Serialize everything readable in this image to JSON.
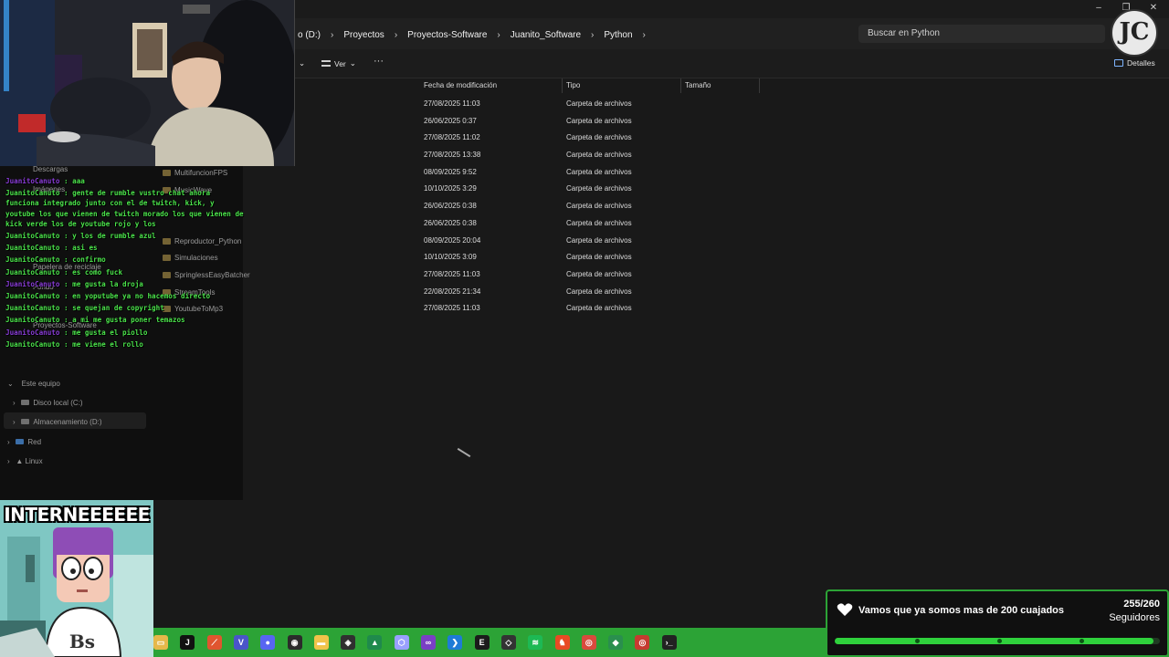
{
  "window": {
    "minimize_glyph": "–",
    "maximize_glyph": "❐",
    "close_glyph": "✕"
  },
  "address": {
    "crumbs": [
      "o (D:)",
      "Proyectos",
      "Proyectos-Software",
      "Juanito_Software",
      "Python"
    ],
    "chevron": "›",
    "search_placeholder": "Buscar en Python"
  },
  "toolbar": {
    "view_label": "Ver",
    "more_label": "···",
    "details_label": "Detalles"
  },
  "list": {
    "columns": [
      "Fecha de modificación",
      "Tipo",
      "Tamaño"
    ],
    "rows": [
      {
        "date": "27/08/2025 11:03",
        "type": "Carpeta de archivos"
      },
      {
        "date": "26/06/2025 0:37",
        "type": "Carpeta de archivos"
      },
      {
        "date": "27/08/2025 11:02",
        "type": "Carpeta de archivos"
      },
      {
        "date": "27/08/2025 13:38",
        "type": "Carpeta de archivos"
      },
      {
        "date": "08/09/2025 9:52",
        "type": "Carpeta de archivos"
      },
      {
        "date": "10/10/2025 3:29",
        "type": "Carpeta de archivos"
      },
      {
        "date": "26/06/2025 0:38",
        "type": "Carpeta de archivos"
      },
      {
        "date": "26/06/2025 0:38",
        "type": "Carpeta de archivos"
      },
      {
        "date": "08/09/2025 20:04",
        "type": "Carpeta de archivos"
      },
      {
        "date": "10/10/2025 3:09",
        "type": "Carpeta de archivos"
      },
      {
        "date": "27/08/2025 11:03",
        "type": "Carpeta de archivos"
      },
      {
        "date": "22/08/2025 21:34",
        "type": "Carpeta de archivos"
      },
      {
        "date": "27/08/2025 11:03",
        "type": "Carpeta de archivos"
      }
    ]
  },
  "nav": {
    "quick": [
      "Descargas",
      "Imágenes",
      "Papelera de reciclaje",
      "Fondo",
      "Proyectos-Software"
    ],
    "folders": [
      "MultifuncionFPS",
      "MusicWave",
      "Reproductor_Python",
      "Simulaciones",
      "SpringlessEasyBatcher",
      "StreamTools",
      "YoutubeToMp3"
    ],
    "this_pc": "Este equipo",
    "drive_c": "Disco local (C:)",
    "drive_d": "Almacenamiento (D:)",
    "network": "Red",
    "linux": "Linux",
    "expander": "›",
    "expanded": "⌄"
  },
  "chat": [
    {
      "user": "JuanitoCanuto",
      "color": "purple",
      "msg": "aaa"
    },
    {
      "user": "JuanitoCanuto",
      "color": "green",
      "msg": "gente de rumble vustro chat ahora funciona integrado junto con el de twitch, kick, y youtube los que vienen de twitch morado los que vienen de kick verde los de youtube rojo y los"
    },
    {
      "user": "JuanitoCanuto",
      "color": "green",
      "msg": "y los de rumble azul"
    },
    {
      "user": "JuanitoCanuto",
      "color": "green",
      "msg": "asi es"
    },
    {
      "user": "JuanitoCanuto",
      "color": "green",
      "msg": "confirmo"
    },
    {
      "user": "JuanitoCanuto",
      "color": "green",
      "msg": "es como fuck"
    },
    {
      "user": "JuanitoCanuto",
      "color": "purple",
      "msg": "me gusta la droja"
    },
    {
      "user": "JuanitoCanuto",
      "color": "green",
      "msg": "en yoputube ya no hacemos directo"
    },
    {
      "user": "JuanitoCanuto",
      "color": "green",
      "msg": "se quejan de copyright"
    },
    {
      "user": "JuanitoCanuto",
      "color": "green",
      "msg": "a mi me gusta poner temazos"
    },
    {
      "user": "JuanitoCanuto",
      "color": "purple",
      "msg": "me gusta el piollo"
    },
    {
      "user": "JuanitoCanuto",
      "color": "green",
      "msg": "me viene el rollo"
    }
  ],
  "gif": {
    "caption": "INTERNEEEEEE"
  },
  "logo": {
    "letters": "JC"
  },
  "goal": {
    "title": "Vamos que ya somos mas de 200 cuajados",
    "count": "255/260",
    "label": "Seguidores",
    "progress_fraction": 0.981
  },
  "taskbar": {
    "icons": [
      {
        "name": "file-explorer-icon",
        "color": "#e6b84a",
        "glyph": "▭"
      },
      {
        "name": "jetbrains-icon",
        "color": "#111111",
        "glyph": "J"
      },
      {
        "name": "git-icon",
        "color": "#e0552f",
        "glyph": "⟋"
      },
      {
        "name": "vegas-icon",
        "color": "#4a55c9",
        "glyph": "V"
      },
      {
        "name": "discord-icon",
        "color": "#5865f2",
        "glyph": "●"
      },
      {
        "name": "obs-icon",
        "color": "#2b2b2b",
        "glyph": "◉"
      },
      {
        "name": "folder-icon",
        "color": "#f0c34a",
        "glyph": "▬"
      },
      {
        "name": "unity-icon",
        "color": "#303030",
        "glyph": "◈"
      },
      {
        "name": "android-studio-icon",
        "color": "#1f8a4c",
        "glyph": "▲"
      },
      {
        "name": "package-icon",
        "color": "#9aa0ff",
        "glyph": "⬡"
      },
      {
        "name": "visual-studio-icon",
        "color": "#7a3fc4",
        "glyph": "∞"
      },
      {
        "name": "vscode-icon",
        "color": "#1e7bd6",
        "glyph": "❯"
      },
      {
        "name": "epic-games-icon",
        "color": "#1b1b1b",
        "glyph": "E"
      },
      {
        "name": "unity-hub-icon",
        "color": "#333333",
        "glyph": "◇"
      },
      {
        "name": "spotify-icon",
        "color": "#1db954",
        "glyph": "≋"
      },
      {
        "name": "brave-icon",
        "color": "#e84a24",
        "glyph": "♞"
      },
      {
        "name": "chrome-icon",
        "color": "#d94a3d",
        "glyph": "◎"
      },
      {
        "name": "git-kraken-icon",
        "color": "#2a8f4e",
        "glyph": "◆"
      },
      {
        "name": "chrome-dev-icon",
        "color": "#c63b30",
        "glyph": "◎"
      },
      {
        "name": "terminal-icon",
        "color": "#222222",
        "glyph": "›_"
      }
    ]
  }
}
